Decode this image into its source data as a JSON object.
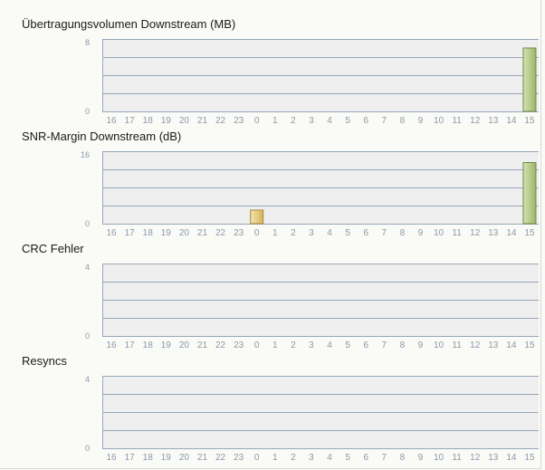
{
  "chart_data": [
    {
      "type": "bar",
      "title": "Übertragungsvolumen Downstream (MB)",
      "categories": [
        "16",
        "17",
        "18",
        "19",
        "20",
        "21",
        "22",
        "23",
        "0",
        "1",
        "2",
        "3",
        "4",
        "5",
        "6",
        "7",
        "8",
        "9",
        "10",
        "11",
        "12",
        "13",
        "14",
        "15"
      ],
      "values": [
        0,
        0,
        0,
        0,
        0,
        0,
        0,
        0,
        0,
        0,
        0,
        0,
        0,
        0,
        0,
        0,
        0,
        0,
        0,
        0,
        0,
        0,
        0,
        7
      ],
      "ylim": [
        0,
        8
      ],
      "yticks": [
        "0",
        "8"
      ],
      "grid": true
    },
    {
      "type": "bar",
      "title": "SNR-Margin Downstream (dB)",
      "categories": [
        "16",
        "17",
        "18",
        "19",
        "20",
        "21",
        "22",
        "23",
        "0",
        "1",
        "2",
        "3",
        "4",
        "5",
        "6",
        "7",
        "8",
        "9",
        "10",
        "11",
        "12",
        "13",
        "14",
        "15"
      ],
      "values": [
        0,
        0,
        0,
        0,
        0,
        0,
        0,
        0,
        3,
        0,
        0,
        0,
        0,
        0,
        0,
        0,
        0,
        0,
        0,
        0,
        0,
        0,
        0,
        13.5
      ],
      "ylim": [
        0,
        16
      ],
      "yticks": [
        "0",
        "16"
      ],
      "grid": true
    },
    {
      "type": "bar",
      "title": "CRC Fehler",
      "categories": [
        "16",
        "17",
        "18",
        "19",
        "20",
        "21",
        "22",
        "23",
        "0",
        "1",
        "2",
        "3",
        "4",
        "5",
        "6",
        "7",
        "8",
        "9",
        "10",
        "11",
        "12",
        "13",
        "14",
        "15"
      ],
      "values": [
        0,
        0,
        0,
        0,
        0,
        0,
        0,
        0,
        0,
        0,
        0,
        0,
        0,
        0,
        0,
        0,
        0,
        0,
        0,
        0,
        0,
        0,
        0,
        0
      ],
      "ylim": [
        0,
        4
      ],
      "yticks": [
        "0",
        "4"
      ],
      "grid": true
    },
    {
      "type": "bar",
      "title": "Resyncs",
      "categories": [
        "16",
        "17",
        "18",
        "19",
        "20",
        "21",
        "22",
        "23",
        "0",
        "1",
        "2",
        "3",
        "4",
        "5",
        "6",
        "7",
        "8",
        "9",
        "10",
        "11",
        "12",
        "13",
        "14",
        "15"
      ],
      "values": [
        0,
        0,
        0,
        0,
        0,
        0,
        0,
        0,
        0,
        0,
        0,
        0,
        0,
        0,
        0,
        0,
        0,
        0,
        0,
        0,
        0,
        0,
        0,
        0
      ],
      "ylim": [
        0,
        4
      ],
      "yticks": [
        "0",
        "4"
      ],
      "grid": true
    }
  ],
  "colors": {
    "plot_background": "#efeff0",
    "grid_line": "#97a8b8",
    "axis_text": "#8a9aaa",
    "bar_current": "#9cb46a",
    "bar_current_light": "#d7e3b2",
    "bar_current_border": "#6e8a44",
    "bar_highlight": "#d4b55c",
    "bar_highlight_light": "#f4e4b0",
    "bar_highlight_border": "#a88a3a"
  }
}
